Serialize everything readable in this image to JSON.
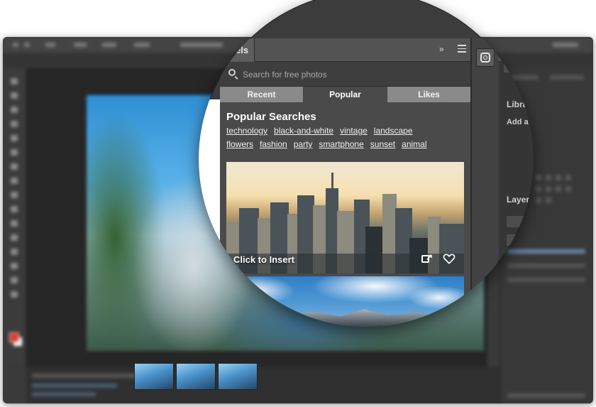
{
  "panel": {
    "title_fragment": "els",
    "collapse_glyph": "»"
  },
  "search": {
    "placeholder": "Search for free photos"
  },
  "tabs": [
    {
      "label": "Recent",
      "active": false
    },
    {
      "label": "Popular",
      "active": true
    },
    {
      "label": "Likes",
      "active": false
    }
  ],
  "popular": {
    "title": "Popular Searches",
    "row1": [
      "technology",
      "black-and-white",
      "vintage",
      "landscape"
    ],
    "row2": [
      "flowers",
      "fashion",
      "party",
      "smartphone",
      "sunset",
      "animal"
    ]
  },
  "photo": {
    "insert_label": "Click to Insert"
  },
  "right_panel": {
    "libraries_fragment": "Libra",
    "add_fragment": "Add a",
    "layers_fragment": "Layer"
  },
  "colors": {
    "panel_bg": "#4a4a4a",
    "tab_inactive": "#8a8a8a",
    "foreground_swatch": "#e23b2e"
  },
  "icons": [
    "search-icon",
    "menu-icon",
    "instagram-icon",
    "external-link-icon",
    "heart-icon"
  ]
}
